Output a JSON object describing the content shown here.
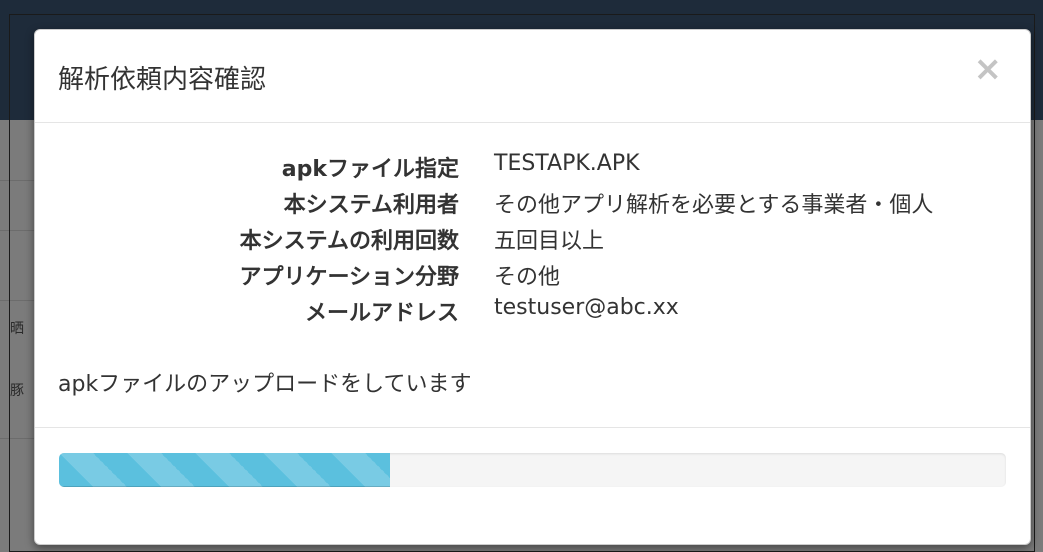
{
  "dialog": {
    "title": "解析依頼内容確認",
    "close_label": "×",
    "fields": [
      {
        "label": "apkファイル指定",
        "value": "TESTAPK.APK"
      },
      {
        "label": "本システム利用者",
        "value": "その他アプリ解析を必要とする事業者・個人"
      },
      {
        "label": "本システムの利用回数",
        "value": "五回目以上"
      },
      {
        "label": "アプリケーション分野",
        "value": "その他"
      },
      {
        "label": "メールアドレス",
        "value": "testuser@abc.xx"
      }
    ],
    "status_message": "apkファイルのアップロードをしています",
    "progress": {
      "fraction": 0.35,
      "color": "#5bc0de"
    }
  },
  "backdrop": {
    "glyphs": [
      "晒",
      "豚"
    ]
  }
}
